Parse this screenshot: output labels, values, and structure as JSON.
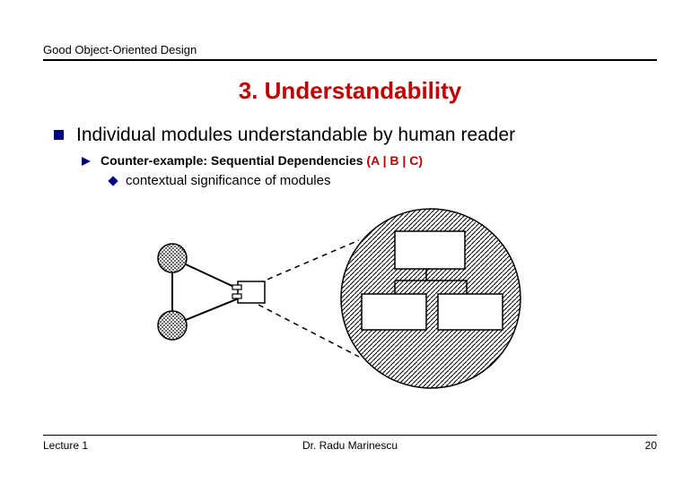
{
  "header": {
    "course": "Good Object-Oriented Design"
  },
  "title": "3. Understandability",
  "bullets": {
    "main": "Individual modules understandable by human reader",
    "sub_prefix": "Counter-example: Sequential Dependencies ",
    "sub_paren_open": "(",
    "sub_a": "A ",
    "sub_bar1": "| ",
    "sub_b": "B ",
    "sub_bar2": "| ",
    "sub_c": "C",
    "sub_paren_close": ")",
    "sub2": "contextual significance of modules"
  },
  "footer": {
    "left": "Lecture 1",
    "center": "Dr. Radu Marinescu",
    "right": "20"
  }
}
